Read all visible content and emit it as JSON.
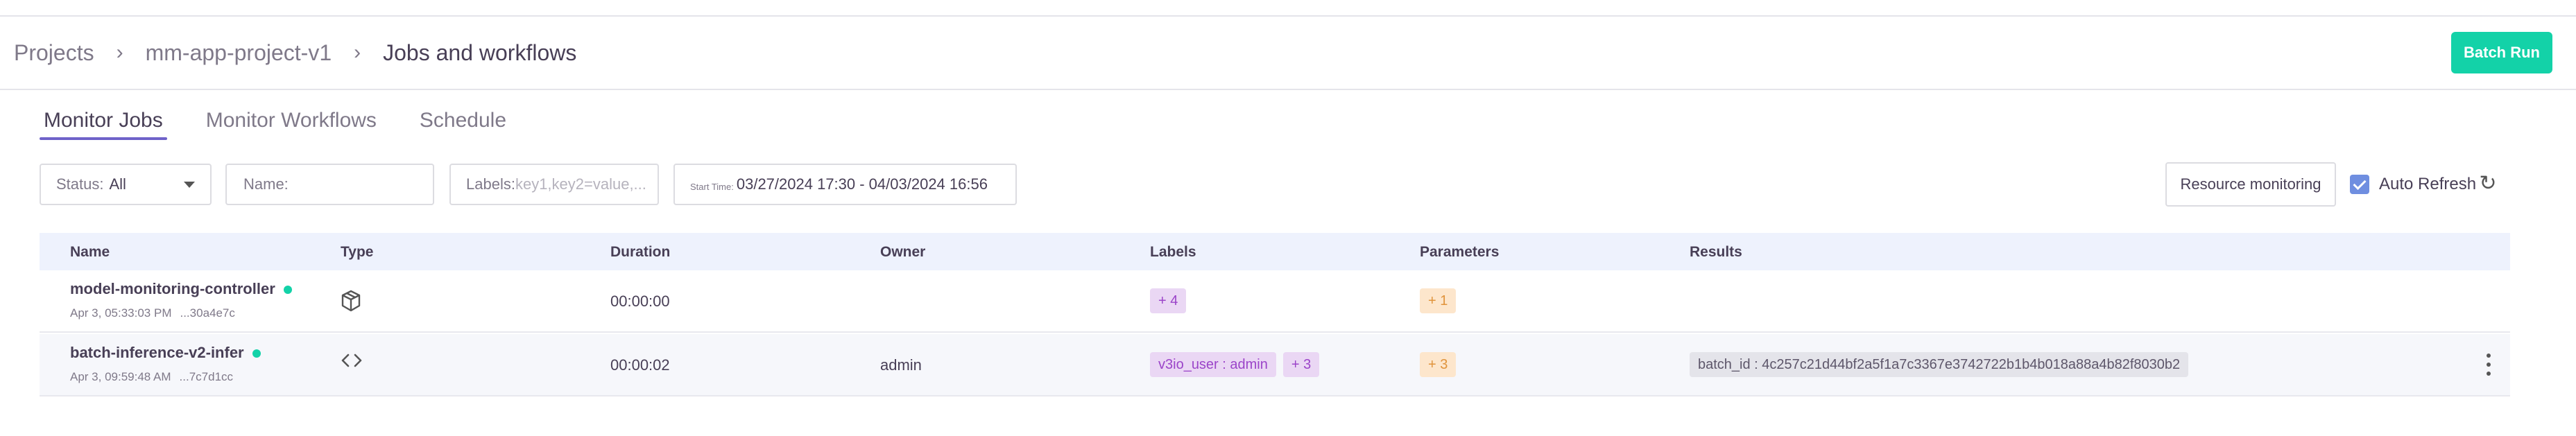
{
  "breadcrumb": {
    "root": "Projects",
    "project": "mm-app-project-v1",
    "current": "Jobs and workflows",
    "separator": "›"
  },
  "header": {
    "batch_run_label": "Batch Run"
  },
  "tabs": [
    {
      "label": "Monitor Jobs",
      "active": true
    },
    {
      "label": "Monitor Workflows",
      "active": false
    },
    {
      "label": "Schedule",
      "active": false
    }
  ],
  "filters": {
    "status": {
      "label": "Status:",
      "value": "All"
    },
    "name": {
      "placeholder": "Name:"
    },
    "labels": {
      "label": "Labels:",
      "placeholder": "key1,key2=value,..."
    },
    "date": {
      "label": "Start Time:",
      "value": "03/27/2024 17:30 - 04/03/2024 16:56"
    }
  },
  "controls": {
    "resource_monitoring_label": "Resource monitoring",
    "auto_refresh_label": "Auto Refresh",
    "auto_refresh_checked": true
  },
  "table": {
    "columns": [
      "Name",
      "Type",
      "Duration",
      "Owner",
      "Labels",
      "Parameters",
      "Results"
    ],
    "rows": [
      {
        "name": "model-monitoring-controller",
        "date": "Apr 3, 05:33:03 PM",
        "uid": "...30a4e7c",
        "type_icon": "package-icon",
        "duration": "00:00:00",
        "owner": "",
        "labels": [
          "+ 4"
        ],
        "parameters": "+ 1",
        "results": ""
      },
      {
        "name": "batch-inference-v2-infer",
        "date": "Apr 3, 09:59:48 AM",
        "uid": "...7c7d1cc",
        "type_icon": "code-icon",
        "duration": "00:00:02",
        "owner": "admin",
        "labels": [
          "v3io_user : admin",
          "+ 3"
        ],
        "parameters": "+ 3",
        "results": "batch_id : 4c257c21d44bf2a5f1a7c3367e3742722b1b4b018a88a4b82f8030b2"
      }
    ]
  },
  "colors": {
    "accent": "#13d2a8",
    "tab_underline": "#6f62c9",
    "header_bg": "#eef2fd"
  }
}
